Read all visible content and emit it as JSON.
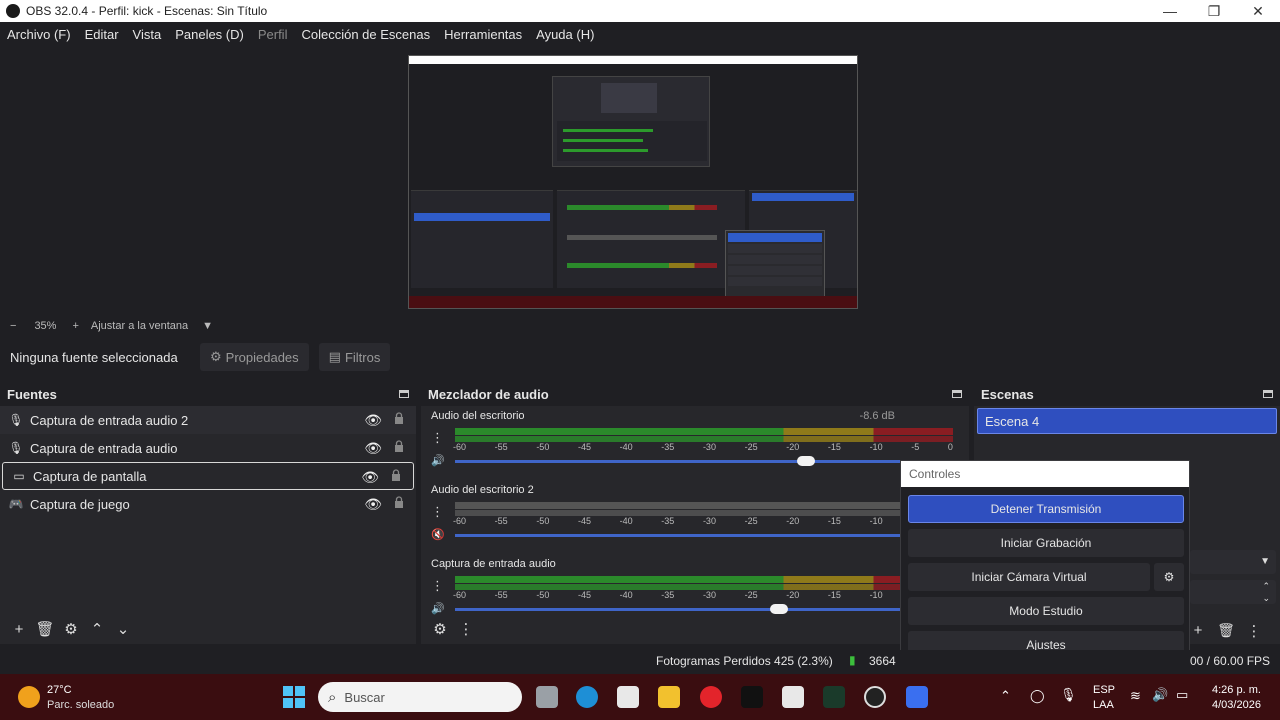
{
  "window": {
    "title": "OBS 32.0.4 - Perfil: kick - Escenas: Sin Título",
    "min": "—",
    "max": "❐",
    "close": "✕"
  },
  "menu": [
    "Archivo (F)",
    "Editar",
    "Vista",
    "Paneles (D)",
    "Perfil",
    "Colección de Escenas",
    "Herramientas",
    "Ayuda (H)"
  ],
  "zoom": {
    "value": "35%",
    "fit": "Ajustar a la ventana"
  },
  "source_toolbar": {
    "no_source": "Ninguna fuente seleccionada",
    "properties": "Propiedades",
    "filters": "Filtros"
  },
  "sources": {
    "title": "Fuentes",
    "items": [
      {
        "label": "Captura de entrada audio 2",
        "icon": "microphone-icon"
      },
      {
        "label": "Captura de entrada audio",
        "icon": "microphone-icon"
      },
      {
        "label": "Captura de pantalla",
        "icon": "monitor-icon"
      },
      {
        "label": "Captura de juego",
        "icon": "gamepad-icon"
      }
    ]
  },
  "mixer": {
    "title": "Mezclador de audio",
    "ticks": [
      "-60",
      "-55",
      "-50",
      "-45",
      "-40",
      "-35",
      "-30",
      "-25",
      "-20",
      "-15",
      "-10",
      "-5",
      "0"
    ],
    "channels": [
      {
        "name": "Audio del escritorio",
        "db": "-8.6 dB",
        "muted": false,
        "level": 0.78
      },
      {
        "name": "Audio del escritorio 2",
        "db": "",
        "muted": true,
        "level": 0.0
      },
      {
        "name": "Captura de entrada audio",
        "db": "",
        "muted": false,
        "level": 0.72
      }
    ]
  },
  "scenes": {
    "title": "Escenas",
    "items": [
      "Escena 4"
    ]
  },
  "controls": {
    "title": "Controles",
    "stop_stream": "Detener Transmisión",
    "start_record": "Iniciar Grabación",
    "start_virtual_cam": "Iniciar Cámara Virtual",
    "studio_mode": "Modo Estudio",
    "settings": "Ajustes"
  },
  "status": {
    "dropped_frames": "Fotogramas Perdidos 425 (2.3%)",
    "bitrate": "3664",
    "fps": "00 / 60.00 FPS"
  },
  "taskbar": {
    "weather_temp": "27°C",
    "weather_desc": "Parc. soleado",
    "search_placeholder": "Buscar",
    "lang1": "ESP",
    "lang2": "LAA",
    "time": "4:26 p. m.",
    "date": "4/03/2026"
  },
  "colors": {
    "accent": "#2f4fbf",
    "meter_green": "#2b8a2b",
    "meter_yellow": "#8f7a1a",
    "meter_red": "#8a1d22",
    "taskbar": "#3a0d10"
  }
}
